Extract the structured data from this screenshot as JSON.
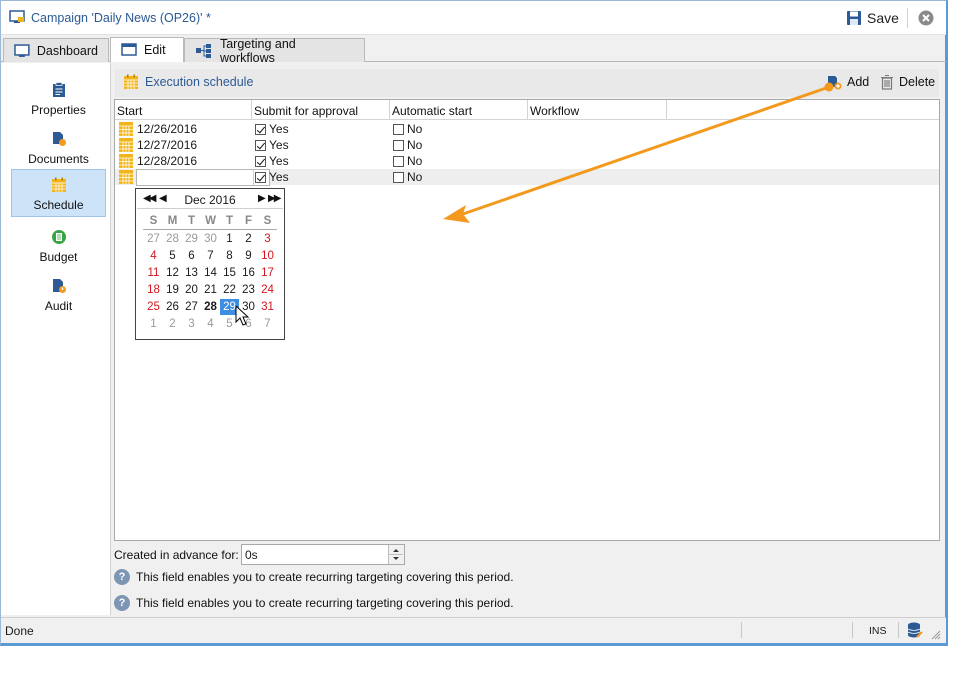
{
  "window": {
    "title": "Campaign 'Daily News (OP26)' *",
    "save_label": "Save"
  },
  "tabs": [
    {
      "label": "Dashboard"
    },
    {
      "label": "Edit"
    },
    {
      "label": "Targeting and workflows"
    }
  ],
  "sidebar": {
    "items": [
      {
        "label": "Properties"
      },
      {
        "label": "Documents"
      },
      {
        "label": "Schedule"
      },
      {
        "label": "Budget"
      },
      {
        "label": "Audit"
      }
    ]
  },
  "schedule": {
    "title": "Execution schedule",
    "add_label": "Add",
    "delete_label": "Delete",
    "columns": [
      "Start",
      "Submit for approval",
      "Automatic start",
      "Workflow"
    ],
    "rows": [
      {
        "start": "12/26/2016",
        "approval": "Yes",
        "auto": "No"
      },
      {
        "start": "12/27/2016",
        "approval": "Yes",
        "auto": "No"
      },
      {
        "start": "12/28/2016",
        "approval": "Yes",
        "auto": "No"
      },
      {
        "start": "",
        "approval": "Yes",
        "auto": "No"
      }
    ]
  },
  "calendar": {
    "month_label": "Dec 2016",
    "weekdays": [
      "S",
      "M",
      "T",
      "W",
      "T",
      "F",
      "S"
    ],
    "weeks": [
      [
        "27",
        "28",
        "29",
        "30",
        "1",
        "2",
        "3"
      ],
      [
        "4",
        "5",
        "6",
        "7",
        "8",
        "9",
        "10"
      ],
      [
        "11",
        "12",
        "13",
        "14",
        "15",
        "16",
        "17"
      ],
      [
        "18",
        "19",
        "20",
        "21",
        "22",
        "23",
        "24"
      ],
      [
        "25",
        "26",
        "27",
        "28",
        "29",
        "30",
        "31"
      ],
      [
        "1",
        "2",
        "3",
        "4",
        "5",
        "6",
        "7"
      ]
    ],
    "selected_day": "29",
    "today_day": "28"
  },
  "advance": {
    "label": "Created in advance for:",
    "value": "0s",
    "help_text": "This field enables you to create recurring targeting covering this period."
  },
  "statusbar": {
    "status": "Done",
    "mode": "INS"
  },
  "colors": {
    "accent": "#2b5a95",
    "selection": "#3d8ee0",
    "weekend": "#d0161d",
    "annotation_arrow": "#f39a1e",
    "calendar_icon": "#f2b418"
  }
}
